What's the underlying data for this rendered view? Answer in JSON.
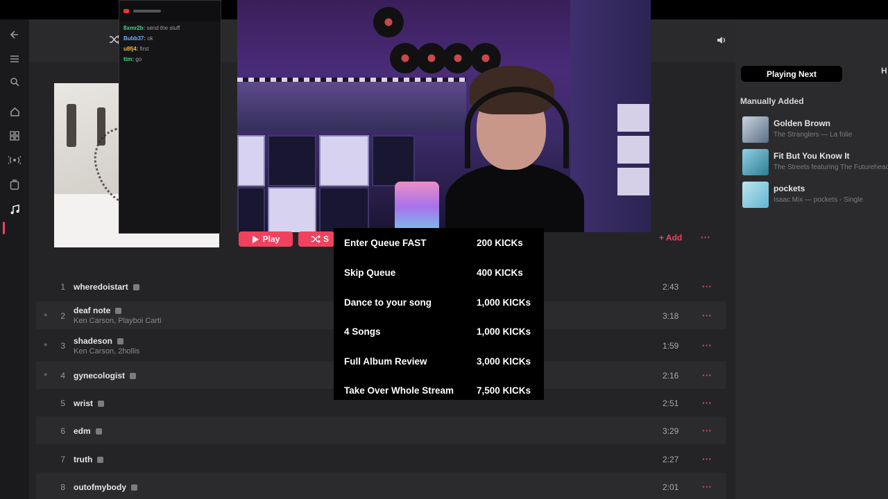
{
  "colors": {
    "accent": "#f0425e",
    "background": "#242426",
    "panel": "#2b2b2d"
  },
  "sidebar": {
    "icons": [
      "back-arrow-icon",
      "menu-icon",
      "search-icon",
      "home-icon",
      "grid-icon",
      "radio-icon",
      "library-icon",
      "music-note-icon"
    ]
  },
  "header": {
    "icons": [
      "volume-icon",
      "airplay-icon",
      "lyrics-icon",
      "queue-icon"
    ]
  },
  "chat": {
    "lines": [
      {
        "user": "8xmr2b:",
        "text": "send the stuff"
      },
      {
        "user": "Bubb37:",
        "text": "ok"
      },
      {
        "user": "u8fj4:",
        "text": "first"
      },
      {
        "user": "ttm:",
        "text": "go"
      }
    ]
  },
  "kicks_menu": {
    "items": [
      {
        "name": "Enter Queue FAST",
        "price": "200 KICKs"
      },
      {
        "name": "Skip Queue",
        "price": "400 KICKs"
      },
      {
        "name": "Dance to your song",
        "price": "1,000 KICKs"
      },
      {
        "name": "4 Songs",
        "price": "1,000 KICKs"
      },
      {
        "name": "Full Album Review",
        "price": "3,000 KICKs"
      },
      {
        "name": "Take Over Whole Stream",
        "price": "7,500 KICKs"
      }
    ]
  },
  "actions": {
    "play_label": "Play",
    "shuffle_label": "S",
    "add_label": "Add",
    "more_label": "···"
  },
  "tracks": [
    {
      "num": "1",
      "title": "wheredoistart",
      "artist": "",
      "duration": "2:43"
    },
    {
      "num": "2",
      "title": "deaf note",
      "artist": "Ken Carson, Playboi Carti",
      "duration": "3:18"
    },
    {
      "num": "3",
      "title": "shadeson",
      "artist": "Ken Carson, 2hollis",
      "duration": "1:59"
    },
    {
      "num": "4",
      "title": "gynecologist",
      "artist": "",
      "duration": "2:16"
    },
    {
      "num": "5",
      "title": "wrist",
      "artist": "",
      "duration": "2:51"
    },
    {
      "num": "6",
      "title": "edm",
      "artist": "",
      "duration": "3:29"
    },
    {
      "num": "7",
      "title": "truth",
      "artist": "",
      "duration": "2:27"
    },
    {
      "num": "8",
      "title": "outofmybody",
      "artist": "",
      "duration": "2:01"
    }
  ],
  "right_panel": {
    "tab_active": "Playing Next",
    "tab_other": "H",
    "heading": "Manually Added",
    "queue": [
      {
        "title": "Golden Brown",
        "subtitle": "The Stranglers — La folie"
      },
      {
        "title": "Fit But You Know It",
        "subtitle": "The Streets featuring The Futureheads"
      },
      {
        "title": "pockets",
        "subtitle": "Isaac Mix — pockets - Single"
      }
    ]
  }
}
